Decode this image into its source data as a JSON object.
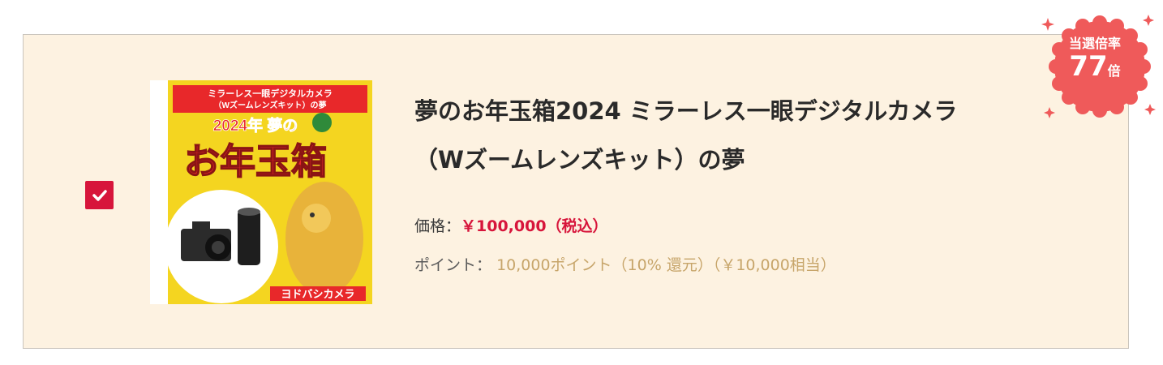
{
  "item": {
    "selected": true,
    "title_line1": "夢のお年玉箱2024 ミラーレス一眼デジタルカメラ",
    "title_line2": "（Wズームレンズキット）の夢",
    "price_label": "価格：",
    "price_value": "￥100,000（税込）",
    "point_label": "ポイント：",
    "point_value": "10,000ポイント（10% 還元）（￥10,000相当）"
  },
  "badge": {
    "label": "当選倍率",
    "value": "77",
    "unit": "倍"
  },
  "thumbnail": {
    "banner_line1": "ミラーレス一眼デジタルカメラ",
    "banner_line2": "（Wズームレンズキット）の夢",
    "year_text": "2024年 夢の",
    "big_text": "お年玉箱",
    "store_text": "ヨドバシカメラ"
  },
  "colors": {
    "card_bg": "#fdf2e1",
    "accent_red": "#d7153b",
    "point_gold": "#c7a56a",
    "badge_red": "#ef5a5a"
  }
}
